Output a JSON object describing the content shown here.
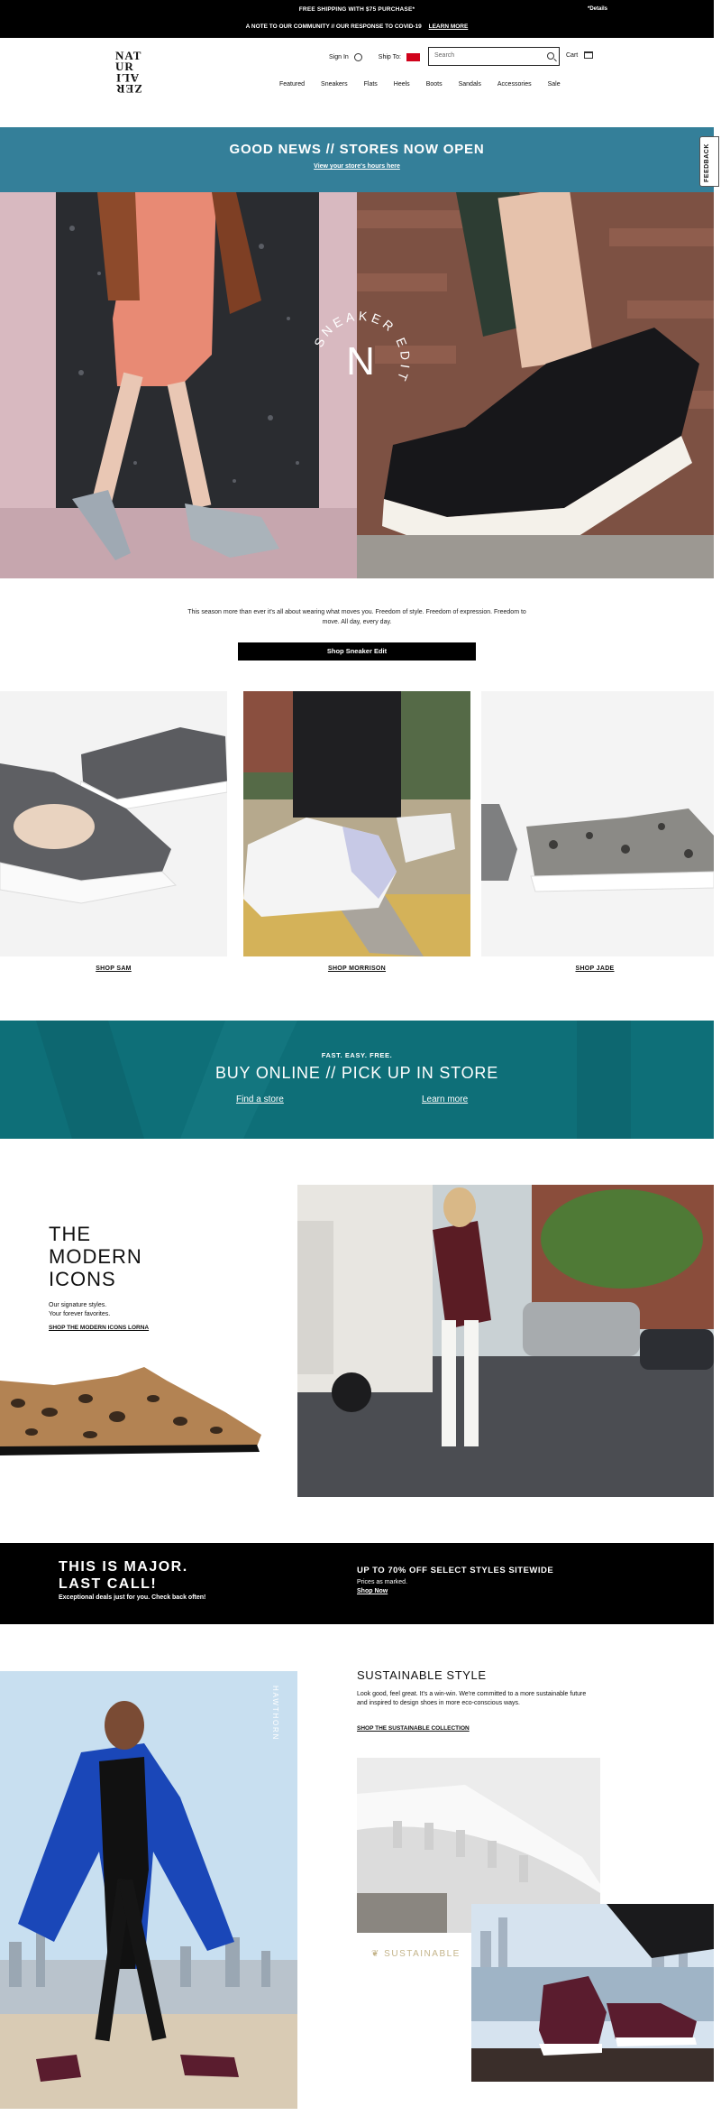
{
  "topbar": {
    "shipping": "FREE SHIPPING WITH $75 PURCHASE*",
    "details": "*Details",
    "note": "A NOTE TO OUR COMMUNITY // OUR RESPONSE TO COVID-19",
    "learn_more": "LEARN MORE"
  },
  "header": {
    "logo_line1": "NAT",
    "logo_line2": "UR",
    "logo_line3": "ALI",
    "logo_line4": "ZER",
    "sign_in": "Sign In",
    "ship_to": "Ship To:",
    "search_placeholder": "Search",
    "cart": "Cart"
  },
  "nav": [
    "Featured",
    "Sneakers",
    "Flats",
    "Heels",
    "Boots",
    "Sandals",
    "Accessories",
    "Sale"
  ],
  "banner": {
    "title": "GOOD NEWS // STORES NOW OPEN",
    "link": "View your store's hours here"
  },
  "feedback": "FEEDBACK",
  "hero": {
    "overlay_text": "SNEAKER EDIT",
    "overlay_letter": "N"
  },
  "intro": {
    "text": "This season more than ever it's all about wearing what moves you. Freedom of style. Freedom of expression. Freedom to move. All day, every day.",
    "button": "Shop Sneaker Edit"
  },
  "tiles": [
    {
      "label": "SHOP SAM"
    },
    {
      "label": "SHOP MORRISON"
    },
    {
      "label": "SHOP JADE"
    }
  ],
  "bopis": {
    "kicker": "FAST. EASY. FREE.",
    "title": "BUY ONLINE // PICK UP IN STORE",
    "link1": "Find a store",
    "link2": "Learn more"
  },
  "modern_icons": {
    "title_1": "THE",
    "title_2": "MODERN",
    "title_3": "ICONS",
    "sub_1": "Our signature styles.",
    "sub_2": "Your forever favorites.",
    "link": "SHOP THE MODERN ICONS LORNA"
  },
  "last_call": {
    "title_1": "THIS IS MAJOR.",
    "title_2": "LAST CALL!",
    "sub": "Exceptional deals just for you. Check back often!",
    "right_title": "UP TO 70% OFF SELECT STYLES SITEWIDE",
    "right_sub": "Prices as marked.",
    "right_link": "Shop Now"
  },
  "sustainable": {
    "vertical": "HAWTHORN",
    "title": "SUSTAINABLE STYLE",
    "body": "Look good, feel great. It's a win-win. We're committed to a more sustainable future and inspired to design shoes in more eco-conscious ways.",
    "link": "SHOP THE SUSTAINABLE COLLECTION",
    "badge": "SUSTAINABLE"
  },
  "colors": {
    "banner": "#347f99",
    "bopis": "#0e6f78",
    "topbar": "#000000"
  }
}
